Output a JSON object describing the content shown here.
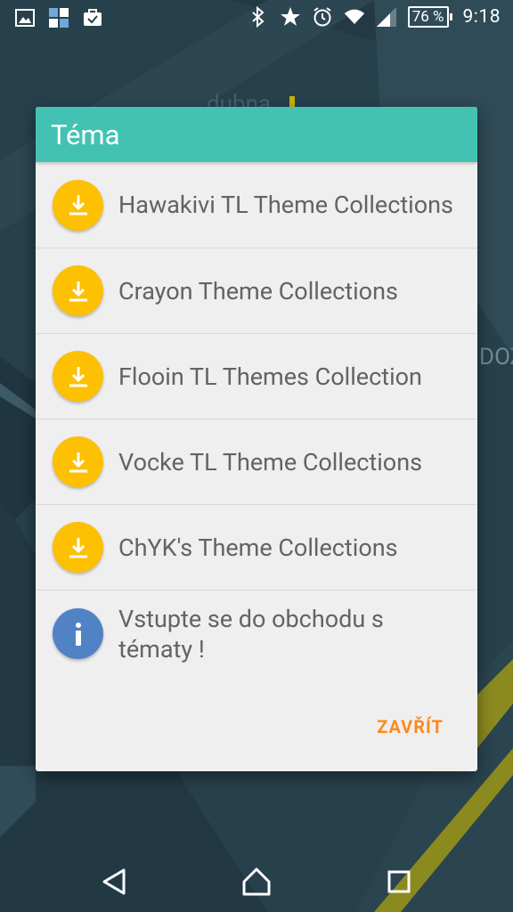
{
  "background": {
    "top_text": "dubna",
    "right_text": "DOZ"
  },
  "status_bar": {
    "battery": "76 %",
    "time": "9:18"
  },
  "dialog": {
    "title": "Téma",
    "items": [
      {
        "label": "Hawakivi TL Theme Collections",
        "icon": "download-icon"
      },
      {
        "label": "Crayon Theme Collections",
        "icon": "download-icon"
      },
      {
        "label": "Flooin TL Themes Collection",
        "icon": "download-icon"
      },
      {
        "label": "Vocke TL Theme Collections",
        "icon": "download-icon"
      },
      {
        "label": "ChYK's Theme Collections",
        "icon": "download-icon"
      },
      {
        "label": "Vstupte se do obchodu s tématy !",
        "icon": "info-icon"
      }
    ],
    "close_label": "ZAVŘÍT"
  },
  "colors": {
    "header": "#43c2b3",
    "download_icon_bg": "#fec002",
    "info_icon_bg": "#5282c6",
    "close_text": "#fb8b1e"
  }
}
